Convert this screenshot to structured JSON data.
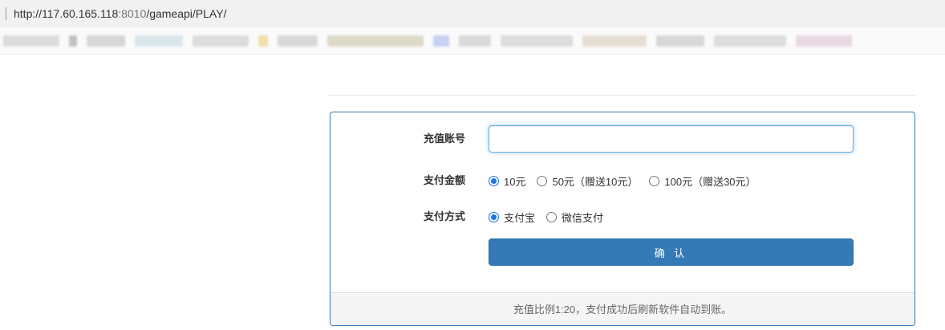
{
  "browser": {
    "url_host": "http://117.60.165.118",
    "url_port": ":8010",
    "url_path": "/gameapi/PLAY/"
  },
  "form": {
    "account_label": "充值账号",
    "account_value": "",
    "amount_label": "支付金额",
    "amount_options": [
      "10元",
      "50元（赠送10元）",
      "100元（赠送30元）"
    ],
    "amount_selected": "10元",
    "method_label": "支付方式",
    "method_options": [
      "支付宝",
      "微信支付"
    ],
    "method_selected": "支付宝",
    "confirm_label": "确 认"
  },
  "footer": {
    "note": "充值比例1:20，支付成功后刷新软件自动到账。"
  },
  "colors": {
    "primary": "#337ab7",
    "radio_accent": "#1a73e8"
  }
}
